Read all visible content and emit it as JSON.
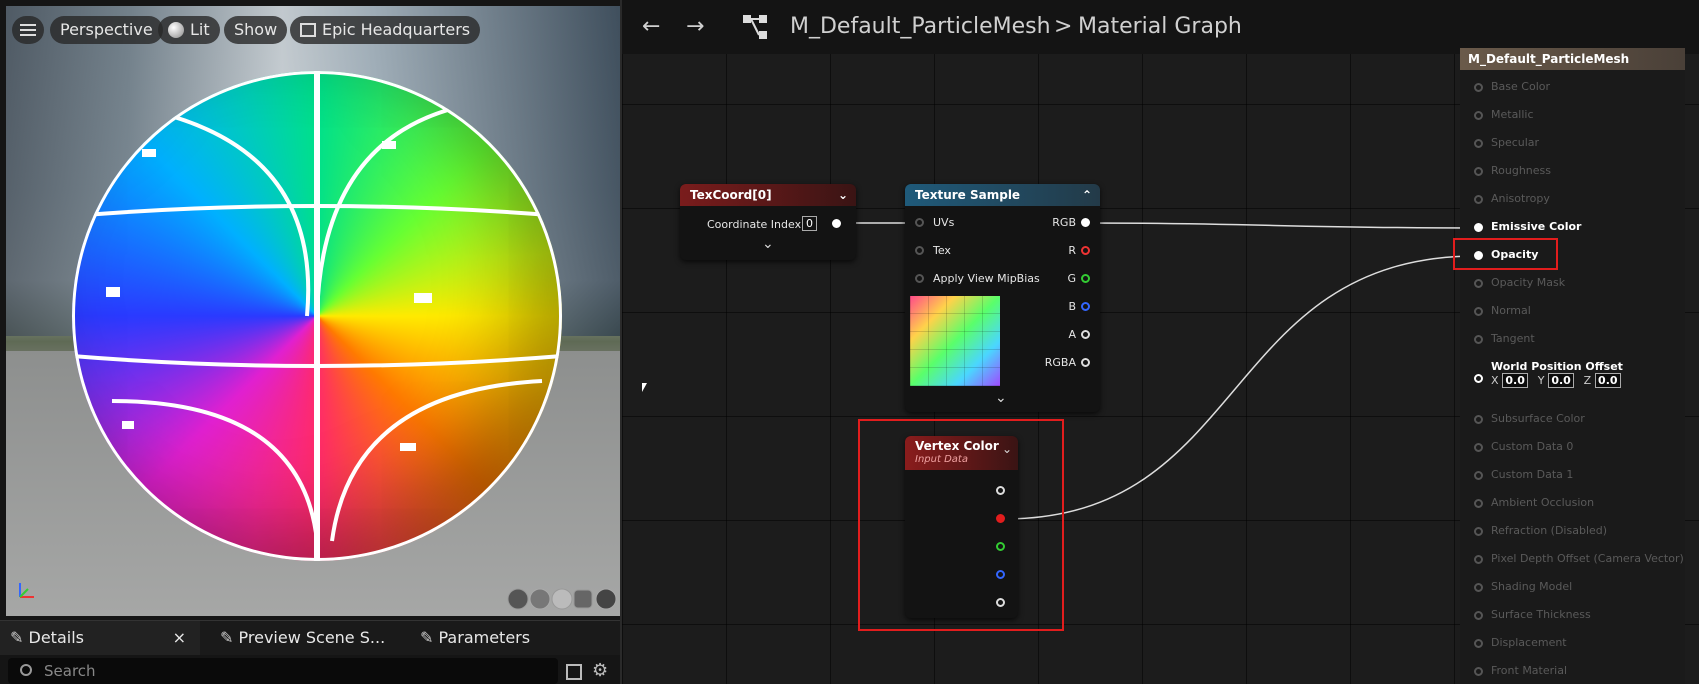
{
  "viewport": {
    "menu_icon": "hamburger-icon",
    "perspective": "Perspective",
    "lit": "Lit",
    "show": "Show",
    "environment": "Epic Headquarters"
  },
  "panel": {
    "tabs": [
      {
        "label": "Details",
        "close": "×"
      },
      {
        "label": "Preview Scene S..."
      },
      {
        "label": "Parameters"
      }
    ],
    "search_placeholder": "Search"
  },
  "graph": {
    "breadcrumb_material": "M_Default_ParticleMesh",
    "breadcrumb_sep": ">",
    "breadcrumb_graph": "Material Graph",
    "texcoord": {
      "title": "TexCoord[0]",
      "label": "Coordinate Index",
      "value": "0"
    },
    "texture_sample": {
      "title": "Texture Sample",
      "inputs": [
        "UVs",
        "Tex",
        "Apply View MipBias"
      ],
      "outputs": [
        "RGB",
        "R",
        "G",
        "B",
        "A",
        "RGBA"
      ]
    },
    "vertex_color": {
      "title": "Vertex Color",
      "subtitle": "Input Data"
    },
    "output_node": {
      "title": "M_Default_ParticleMesh",
      "pins": [
        "Base Color",
        "Metallic",
        "Specular",
        "Roughness",
        "Anisotropy",
        "Emissive Color",
        "Opacity",
        "Opacity Mask",
        "Normal",
        "Tangent",
        "World Position Offset",
        "Subsurface Color",
        "Custom Data 0",
        "Custom Data 1",
        "Ambient Occlusion",
        "Refraction (Disabled)",
        "Pixel Depth Offset (Camera Vector)",
        "Shading Model",
        "Surface Thickness",
        "Displacement",
        "Front Material"
      ],
      "wpo": {
        "x_label": "X",
        "x": "0.0",
        "y_label": "Y",
        "y": "0.0",
        "z_label": "Z",
        "z": "0.0"
      }
    }
  },
  "colors": {
    "highlight": "#e21d1d",
    "texcoord_header": "#7a1c1c",
    "texture_header": "#1f5a7a"
  }
}
